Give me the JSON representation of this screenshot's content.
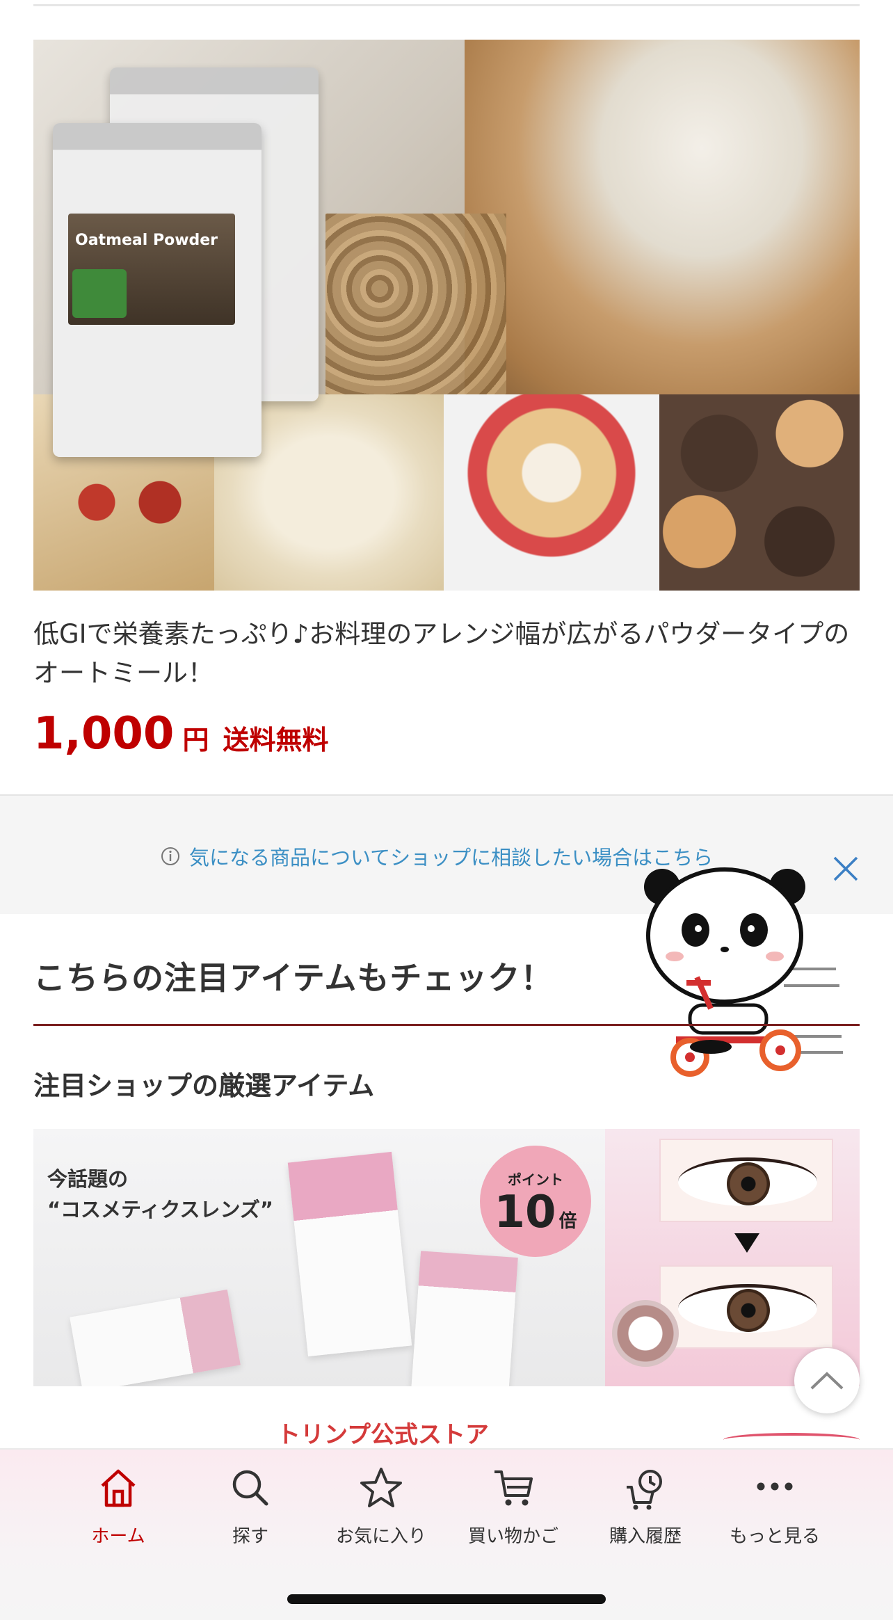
{
  "product": {
    "image_alt": "Oatmeal Powder",
    "package_label": "Oatmeal Powder",
    "description": "低GIで栄養素たっぷり♪お料理のアレンジ幅が広がるパウダータイプのオートミール！",
    "price": "1,000",
    "price_unit": "円",
    "shipping": "送料無料"
  },
  "inquiry": {
    "link_text": "気になる商品についてショップに相談したい場合はこちら"
  },
  "section": {
    "title": "こちらの注目アイテムもチェック！",
    "subtitle": "注目ショップの厳選アイテム"
  },
  "ad": {
    "headline_line1": "今話題の",
    "headline_line2": "“コスメティクスレンズ”",
    "points_label": "ポイント",
    "points_value": "10",
    "points_suffix": "倍",
    "shop_name": "トリンプ公式ストア"
  },
  "nav": {
    "items": [
      {
        "label": "ホーム",
        "icon": "home-icon",
        "active": true
      },
      {
        "label": "探す",
        "icon": "search-icon",
        "active": false
      },
      {
        "label": "お気に入り",
        "icon": "star-icon",
        "active": false
      },
      {
        "label": "買い物かご",
        "icon": "cart-icon",
        "active": false
      },
      {
        "label": "購入履歴",
        "icon": "history-icon",
        "active": false
      },
      {
        "label": "もっと見る",
        "icon": "more-icon",
        "active": false
      }
    ]
  },
  "colors": {
    "accent_red": "#bf0000",
    "link_blue": "#3b8fc4",
    "rule_dark_red": "#7a1f1f"
  }
}
